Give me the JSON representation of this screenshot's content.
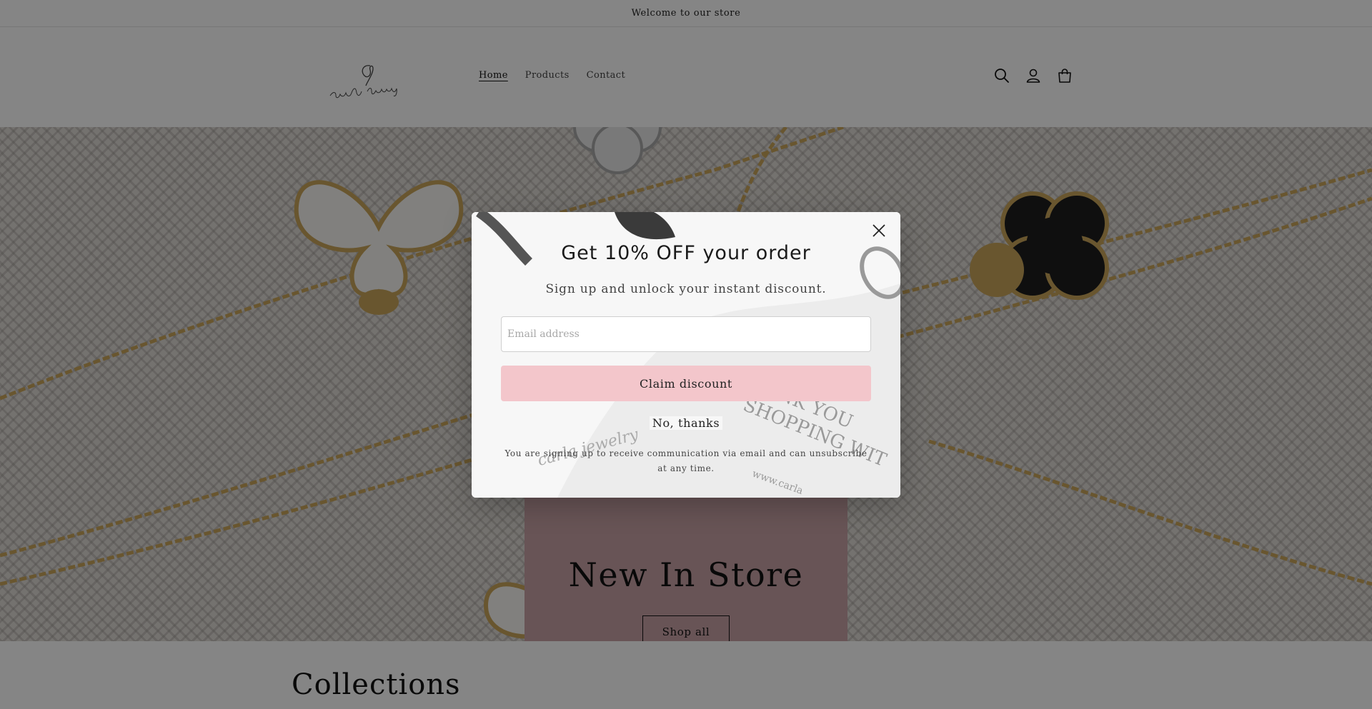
{
  "announcement": {
    "text": "Welcome to our store"
  },
  "header": {
    "logo_text": "carla jewelry",
    "nav": [
      {
        "label": "Home",
        "active": true
      },
      {
        "label": "Products",
        "active": false
      },
      {
        "label": "Contact",
        "active": false
      }
    ],
    "icons": [
      "search-icon",
      "account-icon",
      "cart-icon"
    ]
  },
  "hero": {
    "title": "New In Store",
    "button_label": "Shop all"
  },
  "collections": {
    "title": "Collections"
  },
  "popup": {
    "title": "Get 10% OFF your order",
    "subtitle": "Sign up and unlock your instant discount.",
    "email_placeholder": "Email address",
    "claim_label": "Claim discount",
    "dismiss_label": "No, thanks",
    "disclaimer": "You are signing up to receive communication via email and can unsubscribe at any time.",
    "close_icon": "close-icon"
  },
  "colors": {
    "overlay": "rgba(0,0,0,0.48)",
    "claim_button": "#f3c6cb",
    "hero_box": "#c8a2a6",
    "gold": "#c9a55a"
  }
}
